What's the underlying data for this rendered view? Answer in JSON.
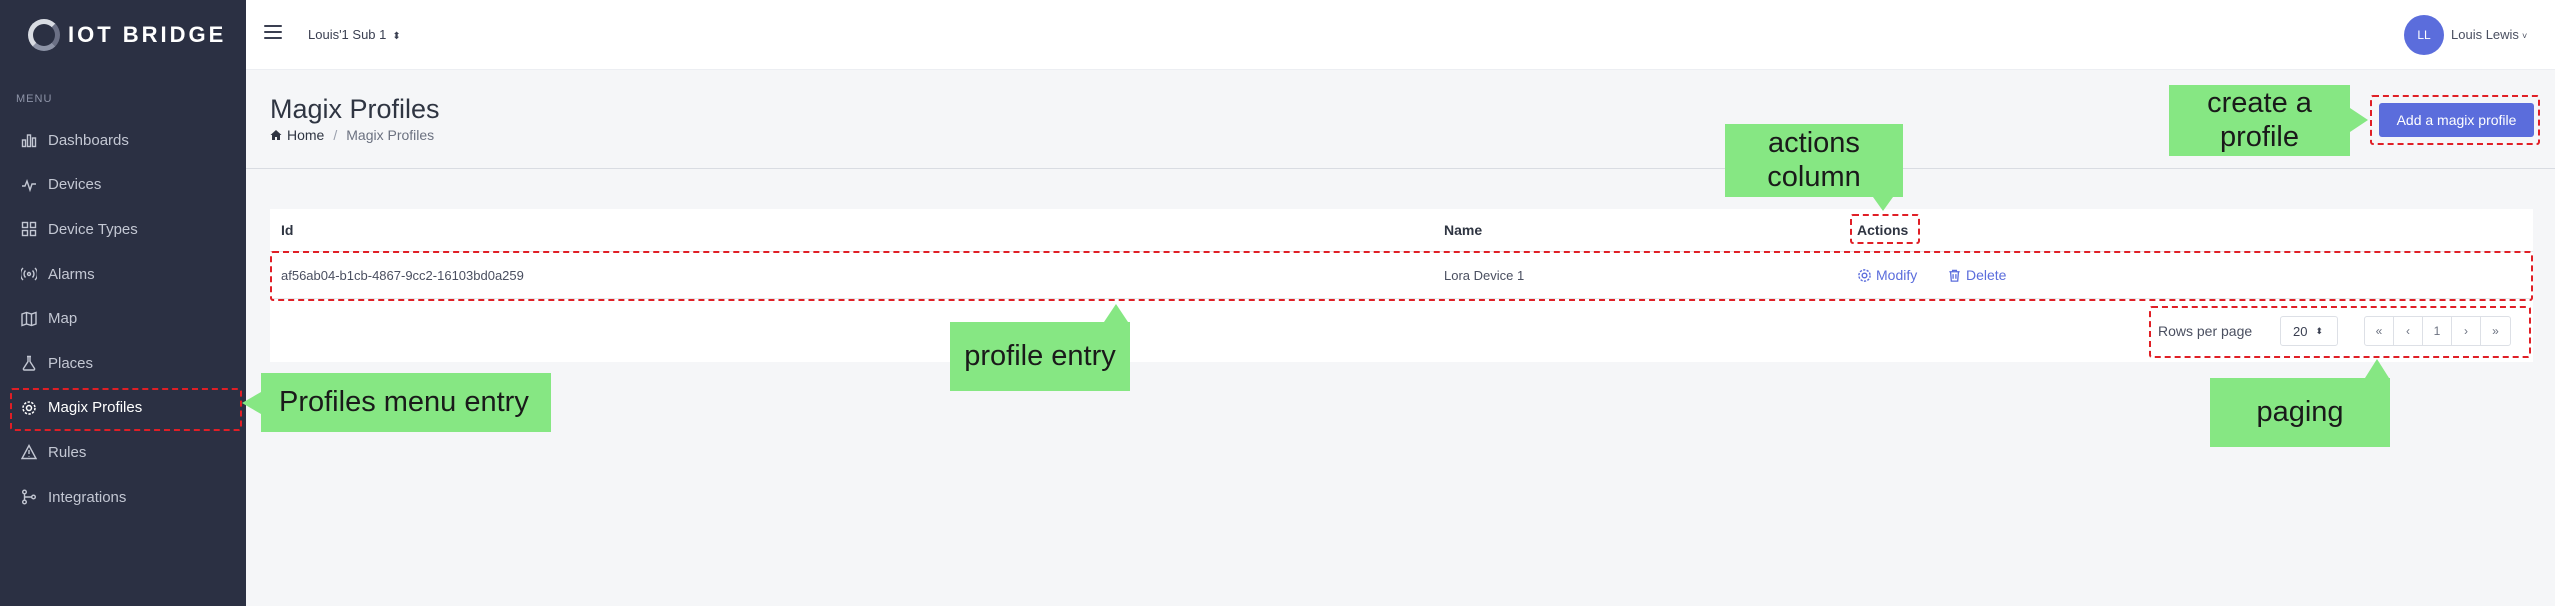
{
  "app": {
    "brand": "IOT BRIDGE",
    "menu_caption": "MENU"
  },
  "sidebar": {
    "items": [
      {
        "label": "Dashboards",
        "icon": "bar-chart-icon"
      },
      {
        "label": "Devices",
        "icon": "pulse-icon"
      },
      {
        "label": "Device Types",
        "icon": "grid-icon"
      },
      {
        "label": "Alarms",
        "icon": "broadcast-icon"
      },
      {
        "label": "Map",
        "icon": "map-icon"
      },
      {
        "label": "Places",
        "icon": "flask-icon"
      },
      {
        "label": "Magix Profiles",
        "icon": "gear-icon",
        "active": true
      },
      {
        "label": "Rules",
        "icon": "warning-icon"
      },
      {
        "label": "Integrations",
        "icon": "integration-icon"
      }
    ]
  },
  "topbar": {
    "tenant": "Louis'1 Sub 1",
    "avatar_initials": "LL",
    "user_name": "Louis Lewis"
  },
  "page": {
    "title": "Magix Profiles",
    "breadcrumb": {
      "home": "Home",
      "current": "Magix Profiles"
    },
    "add_button": "Add a magix profile"
  },
  "table": {
    "columns": [
      "Id",
      "Name",
      "Actions"
    ],
    "rows": [
      {
        "id": "af56ab04-b1cb-4867-9cc2-16103bd0a259",
        "name": "Lora Device 1",
        "actions": [
          "Modify",
          "Delete"
        ]
      }
    ]
  },
  "pagination": {
    "rows_per_page_label": "Rows per page",
    "rows_per_page": "20",
    "buttons": [
      "«",
      "‹",
      "1",
      "›",
      "»"
    ]
  },
  "annotations": {
    "create_profile": "create a profile",
    "actions_column": "actions column",
    "profile_entry": "profile entry",
    "profiles_menu_entry": "Profiles menu entry",
    "paging": "paging"
  },
  "colors": {
    "sidebar_bg": "#2b3043",
    "accent": "#5b6ddc",
    "callout_bg": "#86e783",
    "highlight_border": "#e01f26"
  }
}
